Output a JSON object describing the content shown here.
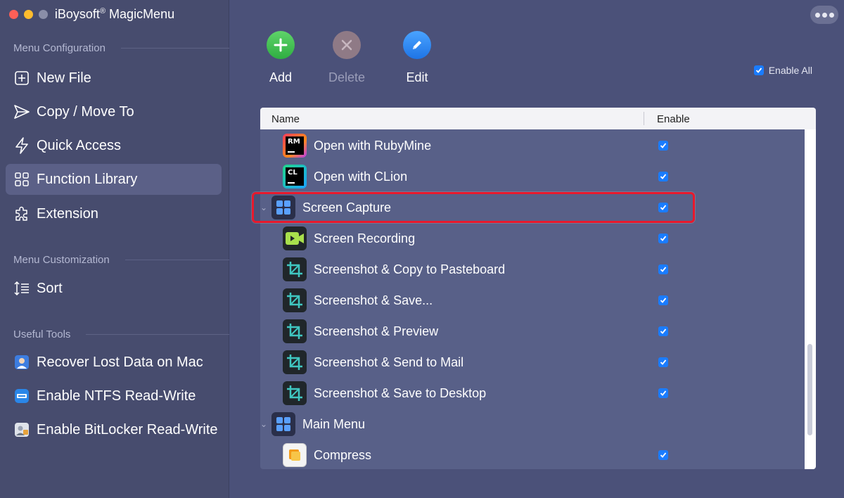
{
  "app": {
    "title": "iBoysoft",
    "title_sup": "®",
    "title_rest": " MagicMenu"
  },
  "sidebar": {
    "section_config": "Menu Configuration",
    "section_custom": "Menu Customization",
    "section_tools": "Useful Tools",
    "items": [
      {
        "label": "New File",
        "icon": "new-file-icon"
      },
      {
        "label": "Copy / Move To",
        "icon": "send-icon"
      },
      {
        "label": "Quick Access",
        "icon": "lightning-icon"
      },
      {
        "label": "Function Library",
        "icon": "grid-icon",
        "active": true
      },
      {
        "label": "Extension",
        "icon": "puzzle-icon"
      }
    ],
    "custom_items": [
      {
        "label": "Sort",
        "icon": "sort-icon"
      }
    ],
    "tools": [
      {
        "label": "Recover Lost Data on Mac",
        "icon": "data-recovery-icon"
      },
      {
        "label": "Enable NTFS Read-Write",
        "icon": "ntfs-icon"
      },
      {
        "label": "Enable BitLocker Read-Write",
        "icon": "bitlocker-icon"
      }
    ]
  },
  "toolbar": {
    "add_label": "Add",
    "delete_label": "Delete",
    "edit_label": "Edit",
    "enable_all_label": "Enable All",
    "enable_all_checked": true
  },
  "table": {
    "col_name": "Name",
    "col_enable": "Enable",
    "rows": [
      {
        "label": "Open with RubyMine",
        "icon": "rubymine-icon",
        "icon_text": "RM",
        "checked": true,
        "level": "child"
      },
      {
        "label": "Open with CLion",
        "icon": "clion-icon",
        "icon_text": "CL",
        "checked": true,
        "level": "child"
      },
      {
        "label": "Screen Capture",
        "icon": "grid-icon",
        "checked": true,
        "level": "parent",
        "highlighted": true
      },
      {
        "label": "Screen Recording",
        "icon": "video-record-icon",
        "checked": true,
        "level": "child"
      },
      {
        "label": "Screenshot & Copy to Pasteboard",
        "icon": "crop-icon",
        "checked": true,
        "level": "child"
      },
      {
        "label": "Screenshot & Save...",
        "icon": "crop-icon",
        "checked": true,
        "level": "child"
      },
      {
        "label": "Screenshot & Preview",
        "icon": "crop-icon",
        "checked": true,
        "level": "child"
      },
      {
        "label": "Screenshot & Send to Mail",
        "icon": "crop-icon",
        "checked": true,
        "level": "child"
      },
      {
        "label": "Screenshot & Save to Desktop",
        "icon": "crop-icon",
        "checked": true,
        "level": "child"
      },
      {
        "label": "Main Menu",
        "icon": "grid-icon",
        "checked": false,
        "level": "parent"
      },
      {
        "label": "Compress",
        "icon": "compress-icon",
        "checked": true,
        "level": "child"
      }
    ]
  },
  "colors": {
    "sidebar_bg": "#474c6e",
    "main_bg": "#4b5179",
    "accent_blue": "#1a7cff",
    "add_green": "#2fae42",
    "highlight_red": "#e8192c"
  }
}
